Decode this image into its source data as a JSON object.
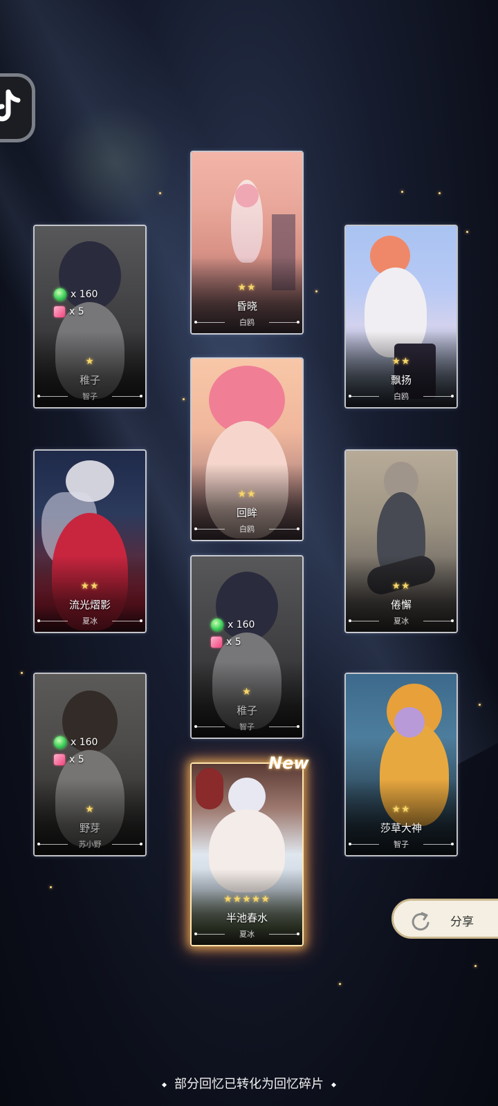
{
  "cards": {
    "c1": {
      "stars": "★★",
      "name": "昏晓",
      "owner": "白鸥"
    },
    "c2": {
      "stars": "★",
      "name": "稚子",
      "owner": "智子",
      "gem_count": "x 160",
      "cube_count": "x 5"
    },
    "c3": {
      "stars": "★★",
      "name": "飘扬",
      "owner": "白鸥"
    },
    "c4": {
      "stars": "★★",
      "name": "回眸",
      "owner": "白鸥"
    },
    "c5": {
      "stars": "★★",
      "name": "流光熠影",
      "owner": "夏冰"
    },
    "c6": {
      "stars": "★★",
      "name": "倦懈",
      "owner": "夏冰"
    },
    "c7": {
      "stars": "★",
      "name": "稚子",
      "owner": "智子",
      "gem_count": "x 160",
      "cube_count": "x 5"
    },
    "c8": {
      "stars": "★",
      "name": "野芽",
      "owner": "苏小野",
      "gem_count": "x 160",
      "cube_count": "x 5"
    },
    "c9": {
      "stars": "★★",
      "name": "莎草大神",
      "owner": "智子"
    },
    "c10": {
      "stars": "★★★★★",
      "name": "半池春水",
      "owner": "夏冰",
      "badge": "New"
    }
  },
  "share": {
    "label": "分享"
  },
  "footer": {
    "text": "部分回忆已转化为回忆碎片"
  },
  "icons": {
    "app": "music-app-icon",
    "share": "share-arrow-icon",
    "gem": "gem-icon",
    "cube": "cube-icon"
  }
}
